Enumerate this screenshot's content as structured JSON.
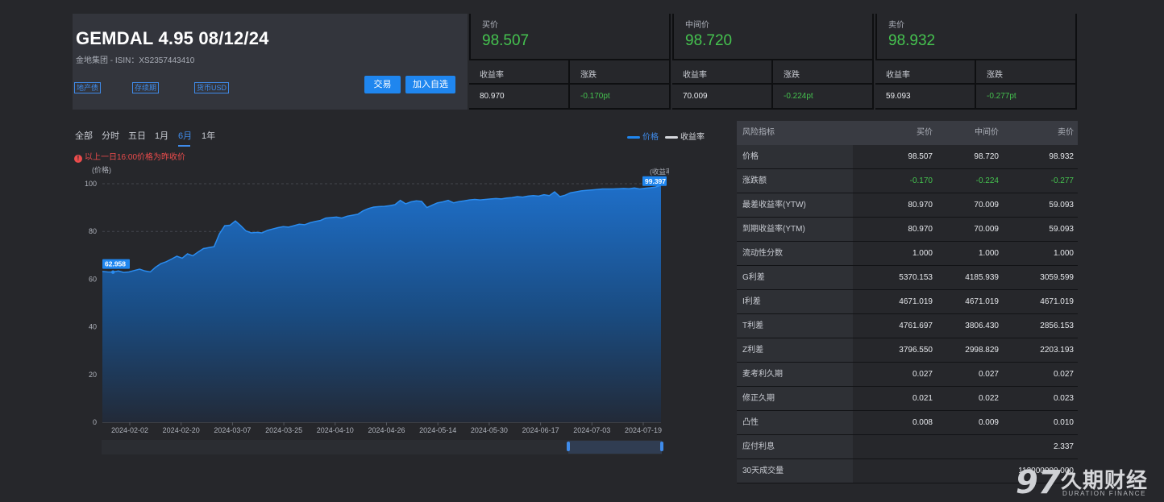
{
  "header": {
    "title": "GEMDAL 4.95 08/12/24",
    "subtitle": "金地集团 - ISIN：XS2357443410",
    "tags": [
      "地产债",
      "存续期",
      "货币USD"
    ],
    "trade_label": "交易",
    "watch_label": "加入自选"
  },
  "quotes": [
    {
      "label": "买价",
      "price": "98.507",
      "yield_label": "收益率",
      "change_label": "涨跌",
      "yield": "80.970",
      "change": "-0.170pt"
    },
    {
      "label": "中间价",
      "price": "98.720",
      "yield_label": "收益率",
      "change_label": "涨跌",
      "yield": "70.009",
      "change": "-0.224pt"
    },
    {
      "label": "卖价",
      "price": "98.932",
      "yield_label": "收益率",
      "change_label": "涨跌",
      "yield": "59.093",
      "change": "-0.277pt"
    }
  ],
  "tabs": [
    "全部",
    "分时",
    "五日",
    "1月",
    "6月",
    "1年"
  ],
  "active_tab": "6月",
  "legend": [
    {
      "label": "价格",
      "color": "#1f86ef"
    },
    {
      "label": "收益率",
      "color": "#d5d7dc"
    }
  ],
  "note": "以上一日16:00价格为昨收价",
  "chart_data": {
    "type": "area",
    "ylabel": "(价格)",
    "y2label": "(收益率)",
    "ylim": [
      0,
      100
    ],
    "yticks": [
      0,
      20,
      40,
      60,
      80,
      100
    ],
    "xticks": [
      "2024-02-02",
      "2024-02-20",
      "2024-03-07",
      "2024-03-25",
      "2024-04-10",
      "2024-04-26",
      "2024-05-14",
      "2024-05-30",
      "2024-06-17",
      "2024-07-03",
      "2024-07-19"
    ],
    "grid": true,
    "series": [
      {
        "name": "价格",
        "color": "#1f86ef",
        "values": [
          63.2,
          63.0,
          62.96,
          63.4,
          62.8,
          63.0,
          63.6,
          64.2,
          63.4,
          63.0,
          65.0,
          66.5,
          67.3,
          68.4,
          69.6,
          68.8,
          70.6,
          69.8,
          71.4,
          72.8,
          73.2,
          73.6,
          79.0,
          82.4,
          82.6,
          84.4,
          82.4,
          80.2,
          79.4,
          79.6,
          79.4,
          80.4,
          81.0,
          81.6,
          82.0,
          81.8,
          82.4,
          83.0,
          82.8,
          83.6,
          84.2,
          84.6,
          85.6,
          85.8,
          86.0,
          85.6,
          86.4,
          86.8,
          87.2,
          88.6,
          89.6,
          90.2,
          90.4,
          90.5,
          90.8,
          91.2,
          93.0,
          91.6,
          92.4,
          92.8,
          92.6,
          90.0,
          91.0,
          92.0,
          92.4,
          93.0,
          92.0,
          92.5,
          92.8,
          93.2,
          93.4,
          93.2,
          93.4,
          93.6,
          93.8,
          93.6,
          94.0,
          94.2,
          94.6,
          94.4,
          94.8,
          95.0,
          94.8,
          95.4,
          95.0,
          96.6,
          94.6,
          95.2,
          96.2,
          96.6,
          97.0,
          97.2,
          97.4,
          97.6,
          97.8,
          97.8,
          97.8,
          97.9,
          98.0,
          97.9,
          98.2,
          97.8,
          98.1,
          98.3,
          98.6,
          99.397
        ]
      }
    ],
    "start_label": "62.958",
    "end_label": "99.397"
  },
  "risk_table": {
    "headers": [
      "风险指标",
      "买价",
      "中间价",
      "卖价"
    ],
    "rows": [
      {
        "name": "价格",
        "bid": "98.507",
        "mid": "98.720",
        "ask": "98.932"
      },
      {
        "name": "涨跌额",
        "bid": "-0.170",
        "mid": "-0.224",
        "ask": "-0.277",
        "green": true
      },
      {
        "name": "最差收益率(YTW)",
        "bid": "80.970",
        "mid": "70.009",
        "ask": "59.093"
      },
      {
        "name": "到期收益率(YTM)",
        "bid": "80.970",
        "mid": "70.009",
        "ask": "59.093"
      },
      {
        "name": "流动性分数",
        "bid": "1.000",
        "mid": "1.000",
        "ask": "1.000"
      },
      {
        "name": "G利差",
        "bid": "5370.153",
        "mid": "4185.939",
        "ask": "3059.599"
      },
      {
        "name": "I利差",
        "bid": "4671.019",
        "mid": "4671.019",
        "ask": "4671.019"
      },
      {
        "name": "T利差",
        "bid": "4761.697",
        "mid": "3806.430",
        "ask": "2856.153"
      },
      {
        "name": "Z利差",
        "bid": "3796.550",
        "mid": "2998.829",
        "ask": "2203.193"
      },
      {
        "name": "麦考利久期",
        "bid": "0.027",
        "mid": "0.027",
        "ask": "0.027"
      },
      {
        "name": "修正久期",
        "bid": "0.021",
        "mid": "0.022",
        "ask": "0.023"
      },
      {
        "name": "凸性",
        "bid": "0.008",
        "mid": "0.009",
        "ask": "0.010"
      },
      {
        "name": "应付利息",
        "bid": "",
        "mid": "",
        "ask": "2.337"
      },
      {
        "name": "30天成交量",
        "bid": "",
        "mid": "",
        "ask": "112000000.000"
      }
    ]
  },
  "watermark": {
    "cn": "久期财经",
    "en": "DURATION FINANCE",
    "logo": "97"
  }
}
